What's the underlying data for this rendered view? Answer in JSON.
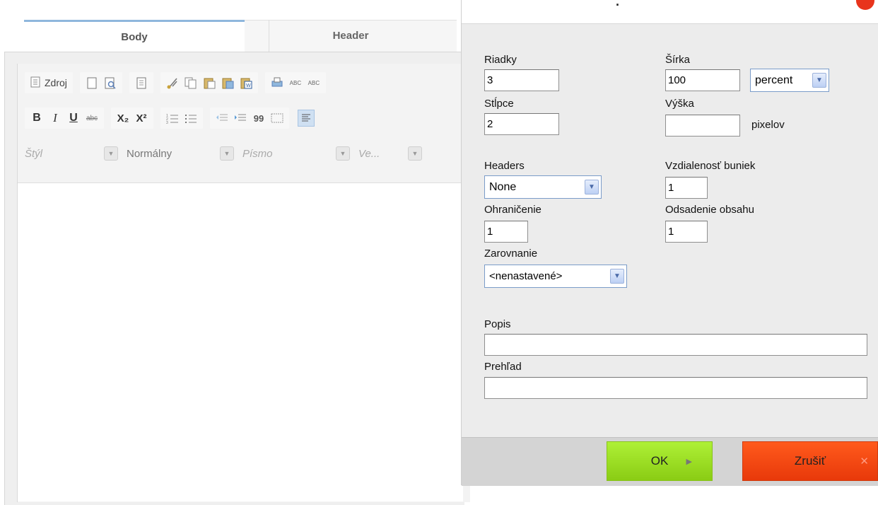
{
  "editor": {
    "tabs": [
      {
        "label": "Body"
      },
      {
        "label": "Header"
      }
    ],
    "toolbar": {
      "source_label": "Zdroj",
      "spell1": "ABC",
      "spell2": "ABC",
      "bold": "B",
      "italic": "I",
      "underline": "U",
      "strike": "abc",
      "subscript": "X₂",
      "superscript": "X²",
      "quote": "99",
      "combos": [
        {
          "label": "Štýl"
        },
        {
          "label": "Normálny"
        },
        {
          "label": "Písmo"
        },
        {
          "label": "Ve..."
        }
      ]
    }
  },
  "dialog": {
    "fields": {
      "riadky": {
        "label": "Riadky",
        "value": "3"
      },
      "stlpce": {
        "label": "Stĺpce",
        "value": "2"
      },
      "sirka": {
        "label": "Šírka",
        "value": "100",
        "unit": "percent"
      },
      "vyska": {
        "label": "Výška",
        "value": "",
        "unit": "pixelov"
      },
      "headers": {
        "label": "Headers",
        "value": "None"
      },
      "vzdialenost": {
        "label": "Vzdialenosť buniek",
        "value": "1"
      },
      "ohranicenie": {
        "label": "Ohraničenie",
        "value": "1"
      },
      "odsadenie": {
        "label": "Odsadenie obsahu",
        "value": "1"
      },
      "zarovnanie": {
        "label": "Zarovnanie",
        "value": "<nenastavené>"
      },
      "popis": {
        "label": "Popis",
        "value": ""
      },
      "prehlad": {
        "label": "Prehľad",
        "value": ""
      }
    },
    "buttons": {
      "ok": "OK",
      "cancel": "Zrušiť"
    }
  },
  "colors": {
    "ok": "#9ee020",
    "cancel": "#f04a12",
    "select_border": "#7a9cc9"
  }
}
